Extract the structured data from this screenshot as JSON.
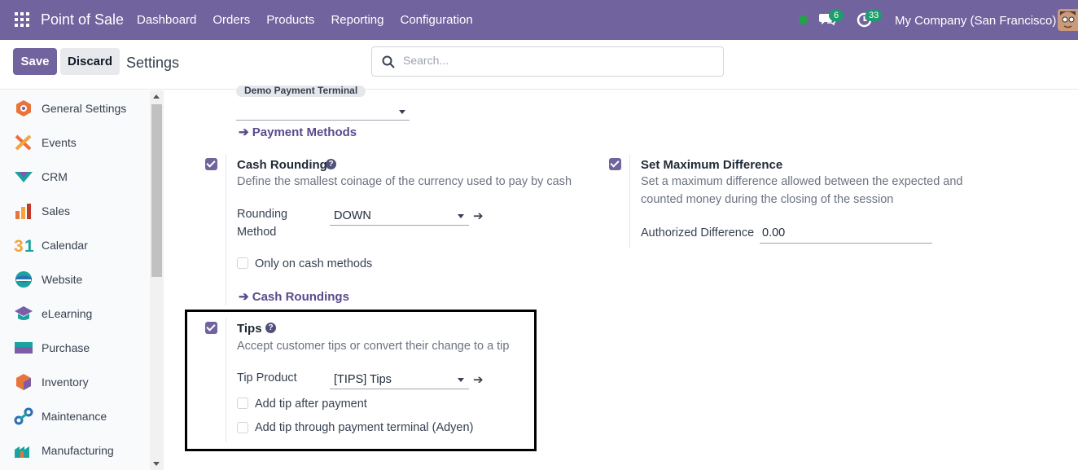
{
  "navbar": {
    "app_name": "Point of Sale",
    "menu": [
      "Dashboard",
      "Orders",
      "Products",
      "Reporting",
      "Configuration"
    ],
    "messages_count": "6",
    "activities_count": "33",
    "company": "My Company (San Francisco)",
    "accent_color": "#71639e"
  },
  "control_panel": {
    "save_label": "Save",
    "discard_label": "Discard",
    "title": "Settings",
    "search_placeholder": "Search..."
  },
  "sidebar": {
    "items": [
      {
        "label": "General Settings",
        "icon": "general-settings-icon"
      },
      {
        "label": "Events",
        "icon": "events-icon"
      },
      {
        "label": "CRM",
        "icon": "crm-icon"
      },
      {
        "label": "Sales",
        "icon": "sales-icon"
      },
      {
        "label": "Calendar",
        "icon": "calendar-icon"
      },
      {
        "label": "Website",
        "icon": "website-icon"
      },
      {
        "label": "eLearning",
        "icon": "elearning-icon"
      },
      {
        "label": "Purchase",
        "icon": "purchase-icon"
      },
      {
        "label": "Inventory",
        "icon": "inventory-icon"
      },
      {
        "label": "Maintenance",
        "icon": "maintenance-icon"
      },
      {
        "label": "Manufacturing",
        "icon": "manufacturing-icon"
      }
    ]
  },
  "payment": {
    "tag": "Demo Payment Terminal",
    "link": "Payment Methods"
  },
  "cash_rounding": {
    "title": "Cash Rounding",
    "description": "Define the smallest coinage of the currency used to pay by cash",
    "rounding_method_label_line1": "Rounding",
    "rounding_method_label_line2": "Method",
    "rounding_method_value": "DOWN",
    "only_cash_label": "Only on cash methods",
    "link": "Cash Roundings",
    "checked": true
  },
  "max_difference": {
    "title": "Set Maximum Difference",
    "description_line1": "Set a maximum difference allowed between the expected and",
    "description_line2": "counted money during the closing of the session",
    "authorized_label": "Authorized Difference",
    "authorized_value": "0.00",
    "checked": true
  },
  "tips": {
    "title": "Tips",
    "description": "Accept customer tips or convert their change to a tip",
    "product_label": "Tip Product",
    "product_value": "[TIPS] Tips",
    "after_payment_label": "Add tip after payment",
    "terminal_label": "Add tip through payment terminal (Adyen)",
    "checked": true
  }
}
